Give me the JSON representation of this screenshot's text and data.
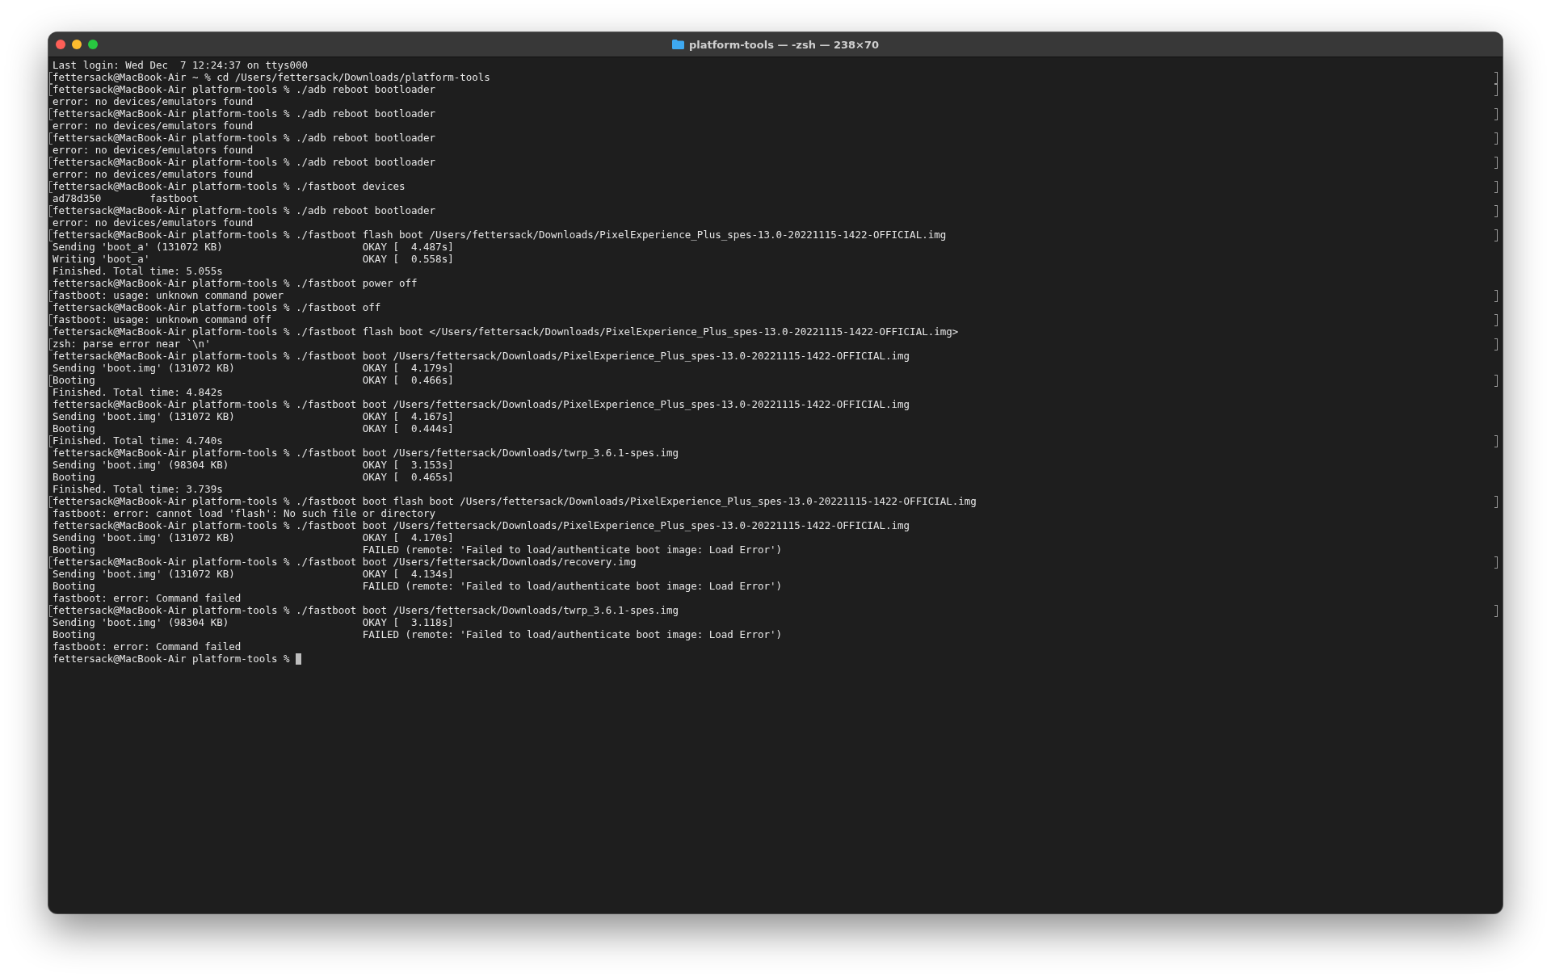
{
  "window": {
    "title": "platform-tools — -zsh — 238×70"
  },
  "terminal": {
    "cursor": true,
    "lines": [
      {
        "text": "Last login: Wed Dec  7 12:24:37 on ttys000",
        "marked": false
      },
      {
        "text": "fettersack@MacBook-Air ~ % cd /Users/fettersack/Downloads/platform-tools",
        "marked": true
      },
      {
        "text": "fettersack@MacBook-Air platform-tools % ./adb reboot bootloader",
        "marked": true
      },
      {
        "text": "error: no devices/emulators found",
        "marked": false
      },
      {
        "text": "fettersack@MacBook-Air platform-tools % ./adb reboot bootloader",
        "marked": true
      },
      {
        "text": "error: no devices/emulators found",
        "marked": false
      },
      {
        "text": "fettersack@MacBook-Air platform-tools % ./adb reboot bootloader",
        "marked": true
      },
      {
        "text": "error: no devices/emulators found",
        "marked": false
      },
      {
        "text": "fettersack@MacBook-Air platform-tools % ./adb reboot bootloader",
        "marked": true
      },
      {
        "text": "error: no devices/emulators found",
        "marked": false
      },
      {
        "text": "fettersack@MacBook-Air platform-tools % ./fastboot devices",
        "marked": true
      },
      {
        "text": "ad78d350\tfastboot",
        "marked": false
      },
      {
        "text": "fettersack@MacBook-Air platform-tools % ./adb reboot bootloader",
        "marked": true
      },
      {
        "text": "error: no devices/emulators found",
        "marked": false
      },
      {
        "text": "fettersack@MacBook-Air platform-tools % ./fastboot flash boot /Users/fettersack/Downloads/PixelExperience_Plus_spes-13.0-20221115-1422-OFFICIAL.img",
        "marked": true
      },
      {
        "text": "Sending 'boot_a' (131072 KB)                       OKAY [  4.487s]",
        "marked": false
      },
      {
        "text": "Writing 'boot_a'                                   OKAY [  0.558s]",
        "marked": false
      },
      {
        "text": "Finished. Total time: 5.055s",
        "marked": false
      },
      {
        "text": "fettersack@MacBook-Air platform-tools % ./fastboot power off",
        "marked": false
      },
      {
        "text": "fastboot: usage: unknown command power",
        "marked": true
      },
      {
        "text": "fettersack@MacBook-Air platform-tools % ./fastboot off",
        "marked": false
      },
      {
        "text": "fastboot: usage: unknown command off",
        "marked": true
      },
      {
        "text": "fettersack@MacBook-Air platform-tools % ./fastboot flash boot </Users/fettersack/Downloads/PixelExperience_Plus_spes-13.0-20221115-1422-OFFICIAL.img>",
        "marked": false
      },
      {
        "text": "zsh: parse error near `\\n'",
        "marked": true
      },
      {
        "text": "fettersack@MacBook-Air platform-tools % ./fastboot boot /Users/fettersack/Downloads/PixelExperience_Plus_spes-13.0-20221115-1422-OFFICIAL.img",
        "marked": false
      },
      {
        "text": "Sending 'boot.img' (131072 KB)                     OKAY [  4.179s]",
        "marked": false
      },
      {
        "text": "Booting                                            OKAY [  0.466s]",
        "marked": true
      },
      {
        "text": "Finished. Total time: 4.842s",
        "marked": false
      },
      {
        "text": "fettersack@MacBook-Air platform-tools % ./fastboot boot /Users/fettersack/Downloads/PixelExperience_Plus_spes-13.0-20221115-1422-OFFICIAL.img",
        "marked": false
      },
      {
        "text": "Sending 'boot.img' (131072 KB)                     OKAY [  4.167s]",
        "marked": false
      },
      {
        "text": "Booting                                            OKAY [  0.444s]",
        "marked": false
      },
      {
        "text": "Finished. Total time: 4.740s",
        "marked": true
      },
      {
        "text": "fettersack@MacBook-Air platform-tools % ./fastboot boot /Users/fettersack/Downloads/twrp_3.6.1-spes.img",
        "marked": false
      },
      {
        "text": "Sending 'boot.img' (98304 KB)                      OKAY [  3.153s]",
        "marked": false
      },
      {
        "text": "Booting                                            OKAY [  0.465s]",
        "marked": false
      },
      {
        "text": "Finished. Total time: 3.739s",
        "marked": false
      },
      {
        "text": "fettersack@MacBook-Air platform-tools % ./fastboot boot flash boot /Users/fettersack/Downloads/PixelExperience_Plus_spes-13.0-20221115-1422-OFFICIAL.img",
        "marked": true
      },
      {
        "text": "fastboot: error: cannot load 'flash': No such file or directory",
        "marked": false
      },
      {
        "text": "fettersack@MacBook-Air platform-tools % ./fastboot boot /Users/fettersack/Downloads/PixelExperience_Plus_spes-13.0-20221115-1422-OFFICIAL.img",
        "marked": false
      },
      {
        "text": "Sending 'boot.img' (131072 KB)                     OKAY [  4.170s]",
        "marked": false
      },
      {
        "text": "Booting                                            FAILED (remote: 'Failed to load/authenticate boot image: Load Error')",
        "marked": false
      },
      {
        "text": "fettersack@MacBook-Air platform-tools % ./fastboot boot /Users/fettersack/Downloads/recovery.img",
        "marked": true
      },
      {
        "text": "Sending 'boot.img' (131072 KB)                     OKAY [  4.134s]",
        "marked": false
      },
      {
        "text": "Booting                                            FAILED (remote: 'Failed to load/authenticate boot image: Load Error')",
        "marked": false
      },
      {
        "text": "fastboot: error: Command failed",
        "marked": false
      },
      {
        "text": "fettersack@MacBook-Air platform-tools % ./fastboot boot /Users/fettersack/Downloads/twrp_3.6.1-spes.img",
        "marked": true
      },
      {
        "text": "Sending 'boot.img' (98304 KB)                      OKAY [  3.118s]",
        "marked": false
      },
      {
        "text": "Booting                                            FAILED (remote: 'Failed to load/authenticate boot image: Load Error')",
        "marked": false
      },
      {
        "text": "fastboot: error: Command failed",
        "marked": false
      },
      {
        "text": "fettersack@MacBook-Air platform-tools % ",
        "marked": false
      }
    ]
  }
}
